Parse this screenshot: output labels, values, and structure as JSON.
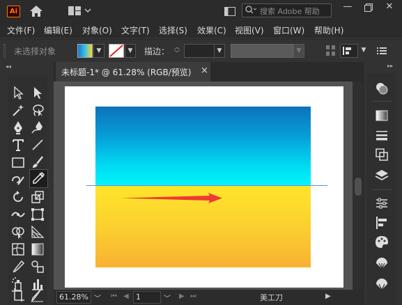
{
  "app": {
    "logo_text": "Ai",
    "search_placeholder": "搜索 Adobe 帮助"
  },
  "menu": [
    "文件(F)",
    "编辑(E)",
    "对象(O)",
    "文字(T)",
    "选择(S)",
    "效果(C)",
    "视图(V)",
    "窗口(W)",
    "帮助(H)"
  ],
  "control_bar": {
    "selection_status": "未选择对象",
    "stroke_label": "描边："
  },
  "document": {
    "tab_title": "未标题-1* @ 61.28% (RGB/预览)",
    "close_glyph": "×"
  },
  "status_bar": {
    "zoom": "61.28%",
    "artboard_number": "1",
    "current_tool": "美工刀"
  },
  "colors": {
    "gradient_top": [
      "#0e72bb",
      "#00f6fa"
    ],
    "gradient_bottom": [
      "#ffe52a",
      "#f9b133"
    ],
    "arrow": "#ee3a32",
    "guide": "#5b8ef0",
    "brand": "#ff7c00"
  }
}
